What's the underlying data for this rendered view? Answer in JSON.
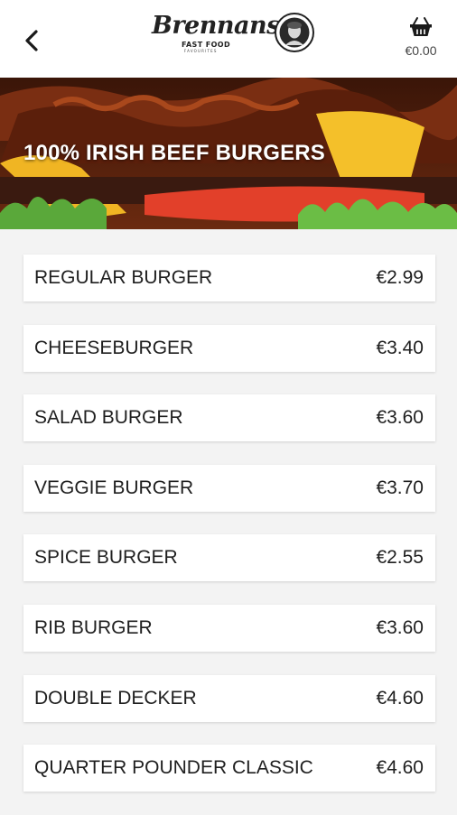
{
  "header": {
    "logo": {
      "wordmark": "Brennans",
      "subtitle": "FAST FOOD",
      "tagline": "FAVOURITES"
    },
    "cart_total": "€0.00"
  },
  "banner": {
    "title": "100% IRISH BEEF BURGERS"
  },
  "menu": {
    "items": [
      {
        "name": "REGULAR BURGER",
        "price": "€2.99"
      },
      {
        "name": "CHEESEBURGER",
        "price": "€3.40"
      },
      {
        "name": "SALAD BURGER",
        "price": "€3.60"
      },
      {
        "name": "VEGGIE BURGER",
        "price": "€3.70"
      },
      {
        "name": "SPICE BURGER",
        "price": "€2.55"
      },
      {
        "name": "RIB BURGER",
        "price": "€3.60"
      },
      {
        "name": "DOUBLE DECKER",
        "price": "€4.60"
      },
      {
        "name": "QUARTER POUNDER CLASSIC",
        "price": "€4.60"
      }
    ]
  },
  "icons": {
    "back": "chevron-left-icon",
    "cart": "basket-icon"
  },
  "colors": {
    "banner_text": "#ffffff",
    "card_bg": "#ffffff",
    "page_bg": "#f3f3f3"
  }
}
